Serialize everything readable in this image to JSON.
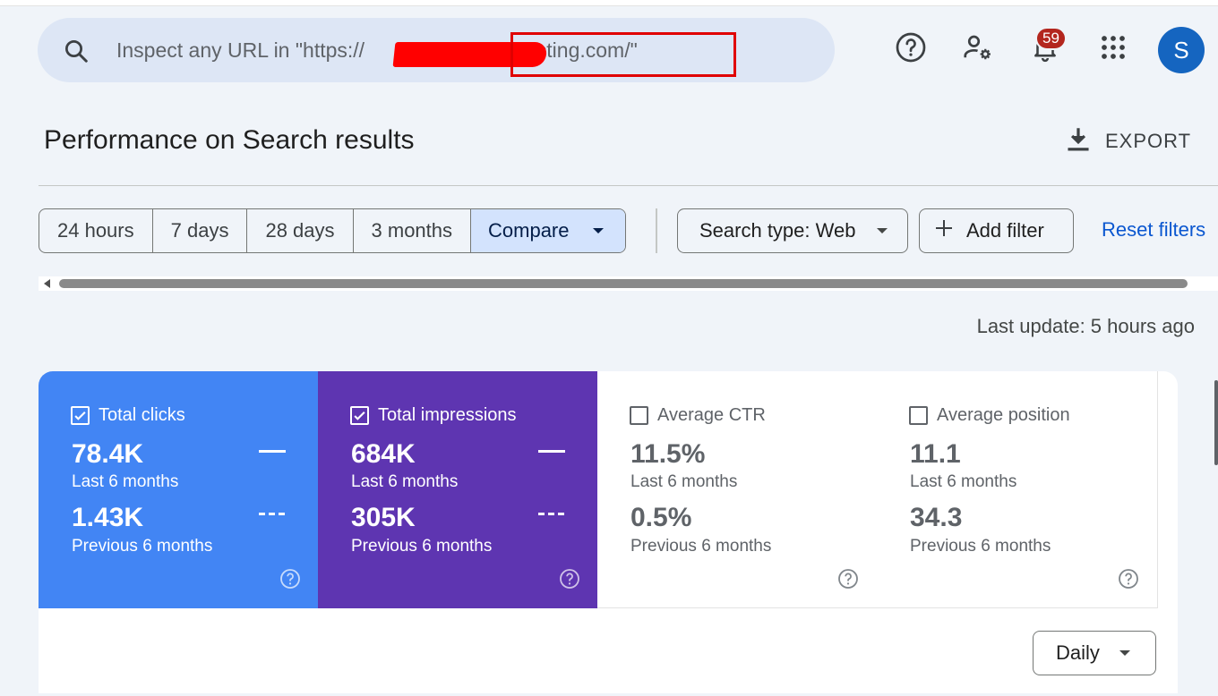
{
  "search": {
    "placeholder": "Inspect any URL in \"https://                    contracting.com/\""
  },
  "header_icons": {
    "help": "help-circle-icon",
    "admin": "manage-accounts-icon",
    "notifications": "bell-icon",
    "apps": "apps-grid-icon",
    "notification_count": "59",
    "avatar_initial": "S"
  },
  "page": {
    "title": "Performance on Search results",
    "export_label": "EXPORT"
  },
  "filters": {
    "ranges": [
      "24 hours",
      "7 days",
      "28 days",
      "3 months"
    ],
    "compare_label": "Compare",
    "search_type_label": "Search type: Web",
    "add_filter_label": "Add filter",
    "reset_label": "Reset filters"
  },
  "last_update": "Last update: 5 hours ago",
  "metrics": {
    "clicks": {
      "label": "Total clicks",
      "checked": true,
      "current": "78.4K",
      "current_period": "Last 6 months",
      "previous": "1.43K",
      "previous_period": "Previous 6 months",
      "color": "#4285f4"
    },
    "impressions": {
      "label": "Total impressions",
      "checked": true,
      "current": "684K",
      "current_period": "Last 6 months",
      "previous": "305K",
      "previous_period": "Previous 6 months",
      "color": "#5e35b1"
    },
    "ctr": {
      "label": "Average CTR",
      "checked": false,
      "current": "11.5%",
      "current_period": "Last 6 months",
      "previous": "0.5%",
      "previous_period": "Previous 6 months"
    },
    "position": {
      "label": "Average position",
      "checked": false,
      "current": "11.1",
      "current_period": "Last 6 months",
      "previous": "34.3",
      "previous_period": "Previous 6 months"
    }
  },
  "granularity": {
    "selected": "Daily"
  },
  "colors": {
    "accent": "#0b57d0",
    "compare_selected": "#d3e3fd",
    "redaction": "#ff0000"
  }
}
